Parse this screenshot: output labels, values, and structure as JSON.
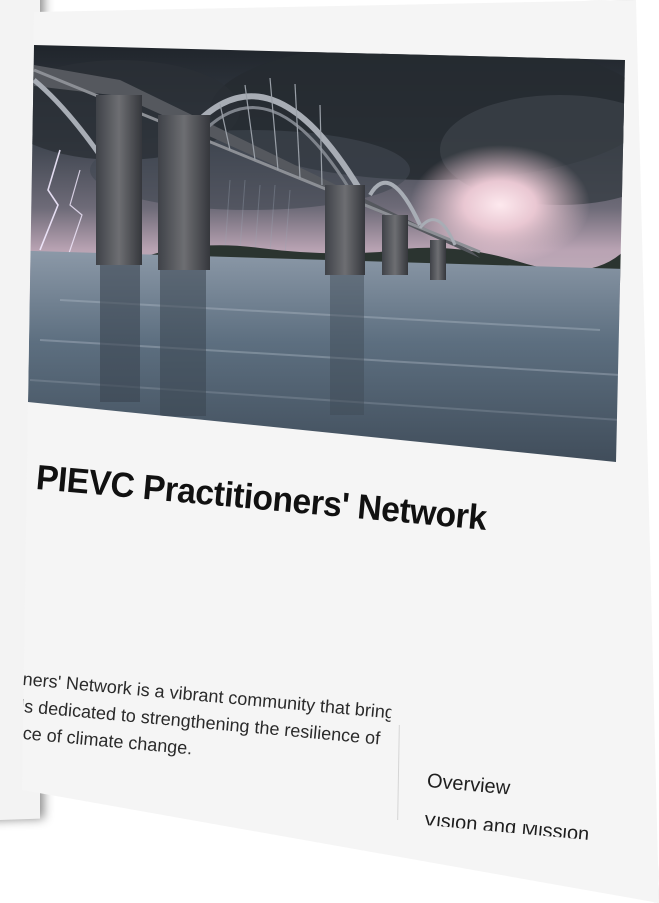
{
  "page": {
    "title": "PIEVC Practitioners' Network",
    "intro_lines": [
      "oners' Network is a vibrant community that brings",
      "als dedicated to strengthening the resilience of",
      "face of climate change."
    ]
  },
  "hero_image": {
    "subject": "steel-arch-bridge-stormy-sky-icon"
  },
  "toc": {
    "items": [
      "Overview",
      "Vision and Mission"
    ]
  },
  "colors": {
    "page_bg": "#f5f5f5",
    "title_text": "#111111",
    "body_text": "#2a2a2a",
    "sky_dark": "#2b3038",
    "water": "#5d6f80"
  }
}
